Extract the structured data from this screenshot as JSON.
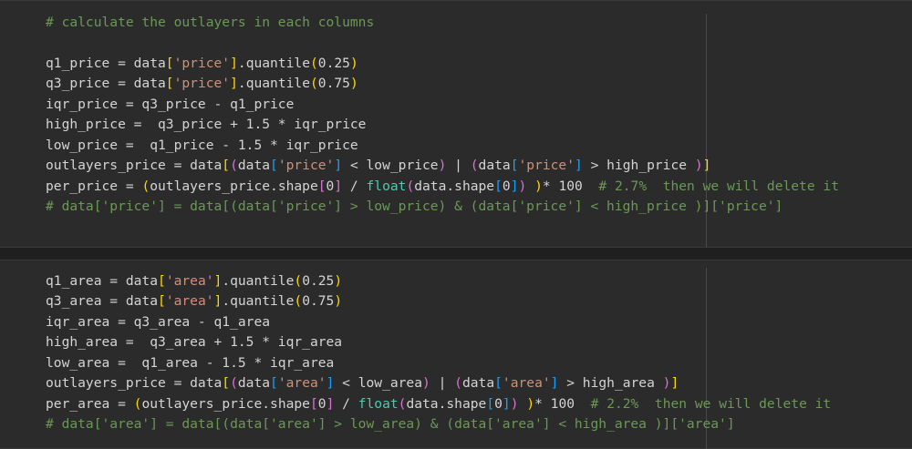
{
  "cells": [
    {
      "lines": [
        [
          {
            "t": "# calculate the outlayers in each columns",
            "c": "comment"
          }
        ],
        [],
        [
          {
            "t": "q1_price = data"
          },
          {
            "t": "[",
            "c": "b1"
          },
          {
            "t": "'price'",
            "c": "str"
          },
          {
            "t": "]",
            "c": "b1"
          },
          {
            "t": ".quantile"
          },
          {
            "t": "(",
            "c": "b1"
          },
          {
            "t": "0.25"
          },
          {
            "t": ")",
            "c": "b1"
          }
        ],
        [
          {
            "t": "q3_price = data"
          },
          {
            "t": "[",
            "c": "b1"
          },
          {
            "t": "'price'",
            "c": "str"
          },
          {
            "t": "]",
            "c": "b1"
          },
          {
            "t": ".quantile"
          },
          {
            "t": "(",
            "c": "b1"
          },
          {
            "t": "0.75"
          },
          {
            "t": ")",
            "c": "b1"
          }
        ],
        [
          {
            "t": "iqr_price = q3_price - q1_price"
          }
        ],
        [
          {
            "t": "high_price =  q3_price + 1.5 * iqr_price"
          }
        ],
        [
          {
            "t": "low_price =  q1_price - 1.5 * iqr_price"
          }
        ],
        [
          {
            "t": "outlayers_price = data"
          },
          {
            "t": "[",
            "c": "b1"
          },
          {
            "t": "(",
            "c": "b2"
          },
          {
            "t": "data"
          },
          {
            "t": "[",
            "c": "b3"
          },
          {
            "t": "'price'",
            "c": "str"
          },
          {
            "t": "]",
            "c": "b3"
          },
          {
            "t": " < low_price"
          },
          {
            "t": ")",
            "c": "b2"
          },
          {
            "t": " | "
          },
          {
            "t": "(",
            "c": "b2"
          },
          {
            "t": "data"
          },
          {
            "t": "[",
            "c": "b3"
          },
          {
            "t": "'price'",
            "c": "str"
          },
          {
            "t": "]",
            "c": "b3"
          },
          {
            "t": " > high_price "
          },
          {
            "t": ")",
            "c": "b2"
          },
          {
            "t": "]",
            "c": "b1"
          }
        ],
        [
          {
            "t": "per_price = "
          },
          {
            "t": "(",
            "c": "b1"
          },
          {
            "t": "outlayers_price.shape"
          },
          {
            "t": "[",
            "c": "b2"
          },
          {
            "t": "0"
          },
          {
            "t": "]",
            "c": "b2"
          },
          {
            "t": " / "
          },
          {
            "t": "float",
            "c": "builtin"
          },
          {
            "t": "(",
            "c": "b2"
          },
          {
            "t": "data.shape"
          },
          {
            "t": "[",
            "c": "b3"
          },
          {
            "t": "0"
          },
          {
            "t": "]",
            "c": "b3"
          },
          {
            "t": ")",
            "c": "b2"
          },
          {
            "t": " "
          },
          {
            "t": ")",
            "c": "b1"
          },
          {
            "t": "* 100  "
          },
          {
            "t": "# 2.7%  then we will delete it",
            "c": "comment"
          }
        ],
        [
          {
            "t": "# data['price'] = data[(data['price'] > low_price) & (data['price'] < high_price )]['price']",
            "c": "comment"
          }
        ]
      ]
    },
    {
      "lines": [
        [
          {
            "t": "q1_area = data"
          },
          {
            "t": "[",
            "c": "b1"
          },
          {
            "t": "'area'",
            "c": "str"
          },
          {
            "t": "]",
            "c": "b1"
          },
          {
            "t": ".quantile"
          },
          {
            "t": "(",
            "c": "b1"
          },
          {
            "t": "0.25"
          },
          {
            "t": ")",
            "c": "b1"
          }
        ],
        [
          {
            "t": "q3_area = data"
          },
          {
            "t": "[",
            "c": "b1"
          },
          {
            "t": "'area'",
            "c": "str"
          },
          {
            "t": "]",
            "c": "b1"
          },
          {
            "t": ".quantile"
          },
          {
            "t": "(",
            "c": "b1"
          },
          {
            "t": "0.75"
          },
          {
            "t": ")",
            "c": "b1"
          }
        ],
        [
          {
            "t": "iqr_area = q3_area - q1_area"
          }
        ],
        [
          {
            "t": "high_area =  q3_area + 1.5 * iqr_area"
          }
        ],
        [
          {
            "t": "low_area =  q1_area - 1.5 * iqr_area"
          }
        ],
        [
          {
            "t": "outlayers_price = data"
          },
          {
            "t": "[",
            "c": "b1"
          },
          {
            "t": "(",
            "c": "b2"
          },
          {
            "t": "data"
          },
          {
            "t": "[",
            "c": "b3"
          },
          {
            "t": "'area'",
            "c": "str"
          },
          {
            "t": "]",
            "c": "b3"
          },
          {
            "t": " < low_area"
          },
          {
            "t": ")",
            "c": "b2"
          },
          {
            "t": " | "
          },
          {
            "t": "(",
            "c": "b2"
          },
          {
            "t": "data"
          },
          {
            "t": "[",
            "c": "b3"
          },
          {
            "t": "'area'",
            "c": "str"
          },
          {
            "t": "]",
            "c": "b3"
          },
          {
            "t": " > high_area "
          },
          {
            "t": ")",
            "c": "b2"
          },
          {
            "t": "]",
            "c": "b1"
          }
        ],
        [
          {
            "t": "per_area = "
          },
          {
            "t": "(",
            "c": "b1"
          },
          {
            "t": "outlayers_price.shape"
          },
          {
            "t": "[",
            "c": "b2"
          },
          {
            "t": "0"
          },
          {
            "t": "]",
            "c": "b2"
          },
          {
            "t": " / "
          },
          {
            "t": "float",
            "c": "builtin"
          },
          {
            "t": "(",
            "c": "b2"
          },
          {
            "t": "data.shape"
          },
          {
            "t": "[",
            "c": "b3"
          },
          {
            "t": "0"
          },
          {
            "t": "]",
            "c": "b3"
          },
          {
            "t": ")",
            "c": "b2"
          },
          {
            "t": " "
          },
          {
            "t": ")",
            "c": "b1"
          },
          {
            "t": "* 100  "
          },
          {
            "t": "# 2.2%  then we will delete it",
            "c": "comment"
          }
        ],
        [
          {
            "t": "# data['area'] = data[(data['area'] > low_area) & (data['area'] < high_area )]['area']",
            "c": "comment"
          }
        ]
      ]
    }
  ],
  "colors": {
    "background": "#2b2b2b",
    "comment": "#6a9955",
    "string": "#ce9178",
    "bracket_level_1": "#ffd700",
    "bracket_level_2": "#da70d6",
    "bracket_level_3": "#179fff",
    "builtin": "#4ec9b0"
  }
}
